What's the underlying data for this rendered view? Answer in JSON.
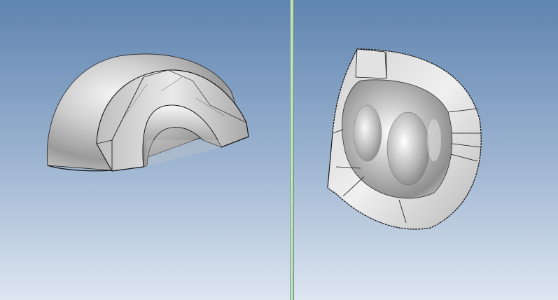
{
  "viewports": {
    "left": {
      "caption": ""
    },
    "right": {
      "caption": ""
    }
  },
  "colors": {
    "bg_top": "#5f84b0",
    "bg_mid": "#9fb6d2",
    "bg_bottom": "#dde6f0",
    "splitter": "#8fc29c",
    "edge": "#111111",
    "metal_light": "#f2f2f2",
    "metal_dark": "#8c8c8c"
  },
  "icons": {
    "left_model": "dome-half-shell-icon",
    "right_model": "cavity-shell-icon"
  }
}
